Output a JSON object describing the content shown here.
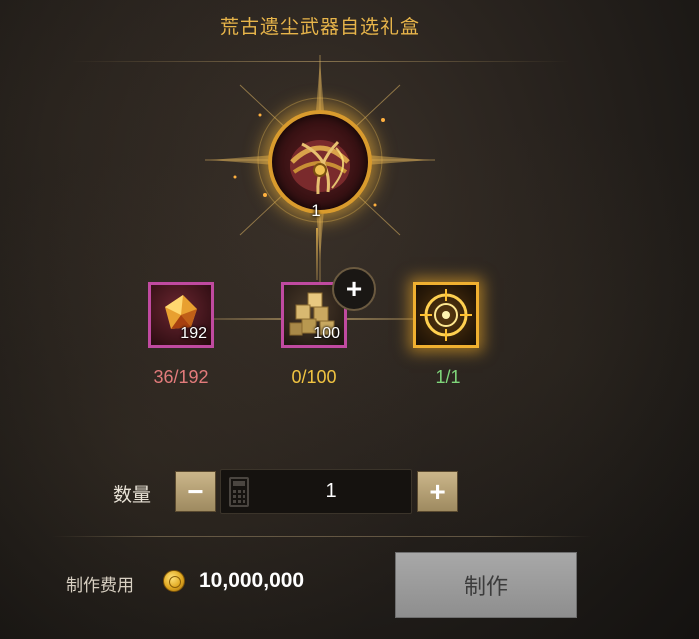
{
  "title": "荒古遗尘武器自选礼盒",
  "main_item": {
    "icon": "treasure-box-icon",
    "count": "1"
  },
  "materials": [
    {
      "icon": "red-ore-icon",
      "badge": "192",
      "progress": "36/192",
      "status_color": "#e27b7b"
    },
    {
      "icon": "gold-blocks-icon",
      "badge": "100",
      "progress": "0/100",
      "status_color": "#f1c441"
    },
    {
      "icon": "golden-emblem-icon",
      "badge": "",
      "progress": "1/1",
      "status_color": "#7fd67a"
    }
  ],
  "quantity": {
    "label": "数量",
    "value": "1",
    "minus": "−",
    "plus": "+"
  },
  "cost": {
    "label": "制作费用",
    "icon": "gold-coin-icon",
    "value": "10,000,000"
  },
  "craft_button": {
    "label": "制作"
  },
  "add_material_button": "+",
  "colors": {
    "title": "#e8b54a",
    "accent_gold": "#d99b2d",
    "craft_button_disabled": "#9e9e9e"
  }
}
